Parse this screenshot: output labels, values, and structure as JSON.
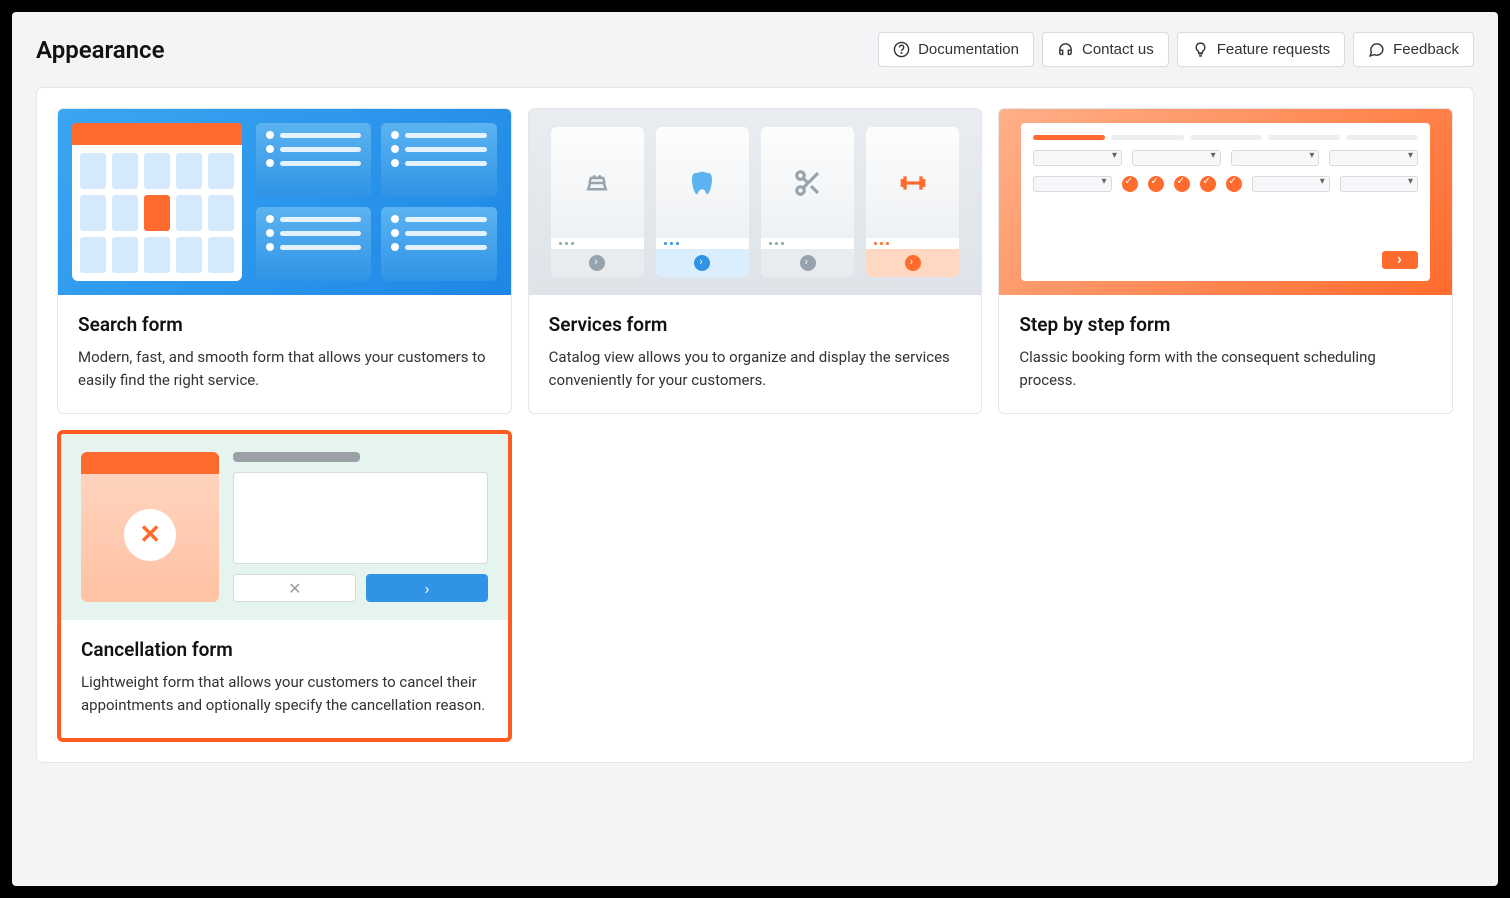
{
  "page": {
    "title": "Appearance"
  },
  "header_buttons": {
    "documentation": "Documentation",
    "contact": "Contact us",
    "feature": "Feature requests",
    "feedback": "Feedback"
  },
  "cards": {
    "search": {
      "title": "Search form",
      "desc": "Modern, fast, and smooth form that allows your customers to easily find the right service."
    },
    "services": {
      "title": "Services form",
      "desc": "Catalog view allows you to organize and display the services conveniently for your customers."
    },
    "step": {
      "title": "Step by step form",
      "desc": "Classic booking form with the consequent scheduling process."
    },
    "cancel": {
      "title": "Cancellation form",
      "desc": "Lightweight form that allows your customers to cancel their appointments and optionally specify the cancellation reason."
    }
  }
}
